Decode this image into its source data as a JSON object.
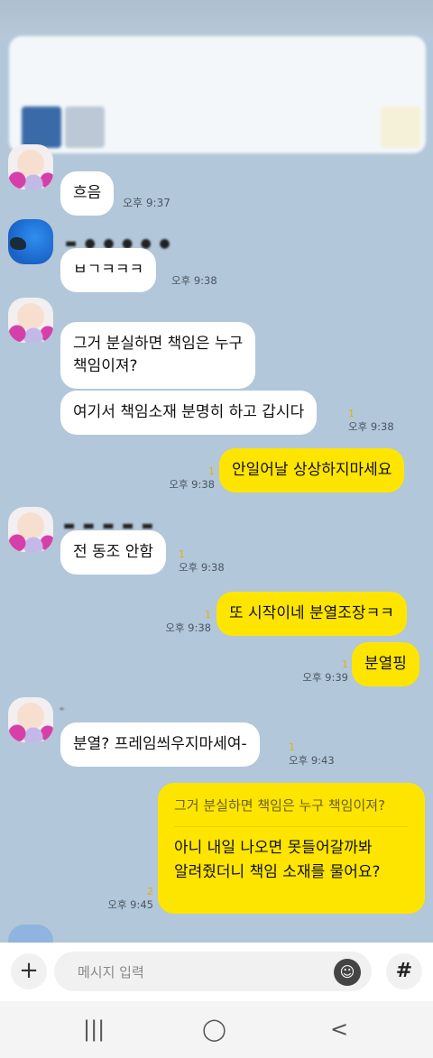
{
  "messages": {
    "m1": {
      "text": "흐음",
      "time": "오후 9:37"
    },
    "m2": {
      "text": "ㅂㄱㅋㅋㅋ",
      "time": "오후 9:38"
    },
    "m3": {
      "text": "그거 분실하면 책임은 누구\n책임이져?"
    },
    "m4": {
      "text": "여기서 책임소재 분명히 하고 갑시다",
      "unread": "1",
      "time": "오후 9:38"
    },
    "m5": {
      "text": "안일어날 상상하지마세요",
      "unread": "1",
      "time": "오후 9:38"
    },
    "m6": {
      "text": "전 동조 안함",
      "unread": "1",
      "time": "오후 9:38"
    },
    "m7": {
      "text": "또 시작이네 분열조장ㅋㅋ",
      "unread": "1",
      "time": "오후 9:38"
    },
    "m8": {
      "text": "분열핑",
      "unread": "1",
      "time": "오후 9:39"
    },
    "m9": {
      "text": "분열? 프레임씌우지마세여-",
      "unread": "1",
      "time": "오후 9:43"
    },
    "m10": {
      "quoted": "그거 분실하면 책임은 누구 책임이져?",
      "text": "아니 내일 나오면 못들어갈까봐\n알려줬더니 책임 소재를 물어요?",
      "unread": "2",
      "time": "오후 9:45"
    }
  },
  "input": {
    "plus": "+",
    "placeholder": "메시지 입력",
    "emoji": "☺",
    "hash": "#"
  },
  "nav": {
    "recents": "|||",
    "home": "◯",
    "back": "<"
  }
}
